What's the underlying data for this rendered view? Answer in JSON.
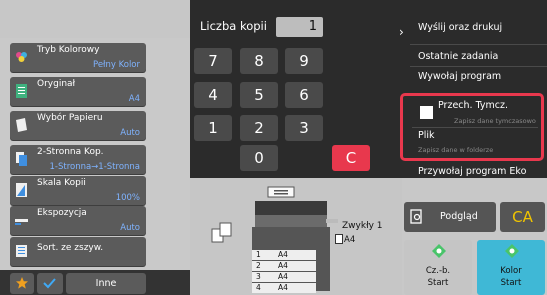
{
  "copies": {
    "label": "Liczba kopii",
    "value": "1"
  },
  "keypad": [
    "7",
    "8",
    "9",
    "4",
    "5",
    "6",
    "1",
    "2",
    "3",
    "0"
  ],
  "clear_key": "C",
  "modes": [
    {
      "title": "Tryb Kolorowy",
      "value": "Pełny Kolor"
    },
    {
      "title": "Oryginał",
      "value": "A4"
    },
    {
      "title": "Wybór Papieru",
      "value": "Auto"
    },
    {
      "title": "2-Stronna Kop.",
      "value": "1-Stronna→1-Stronna"
    },
    {
      "title": "Skala Kopii",
      "value": "100%"
    },
    {
      "title": "Ekspozycja",
      "value": "Auto"
    },
    {
      "title": "Sort. ze zszyw.",
      "value": ""
    }
  ],
  "other_button": "Inne",
  "right_menu": {
    "send_print": "Wyślij oraz drukuj",
    "recent_jobs": "Ostatnie zadania",
    "call_program": "Wywołaj program",
    "temp_save": {
      "title": "Przech. Tymcz.",
      "sub": "Zapisz dane tymczasowo"
    },
    "file": {
      "title": "Plik",
      "sub": "Zapisz dane w folderze"
    },
    "eco_program": "Przywołaj program Eko"
  },
  "preview_button": "Podgląd",
  "ca_button": "CA",
  "bw_start": {
    "line1": "Cz.-b.",
    "line2": "Start"
  },
  "color_start": {
    "line1": "Kolor",
    "line2": "Start"
  },
  "output": {
    "tray_label": "Zwykły 1",
    "tray_size": "A4"
  },
  "trays": [
    {
      "num": "1",
      "size": "A4"
    },
    {
      "num": "2",
      "size": "A4"
    },
    {
      "num": "3",
      "size": "A4"
    },
    {
      "num": "4",
      "size": "A4"
    }
  ],
  "colors": {
    "accent_red": "#e8384d",
    "ca_yellow": "#f0c400",
    "start_bw": "#c5c5c5",
    "start_color": "#3fb8d6",
    "value_blue": "#7fb3ff"
  }
}
